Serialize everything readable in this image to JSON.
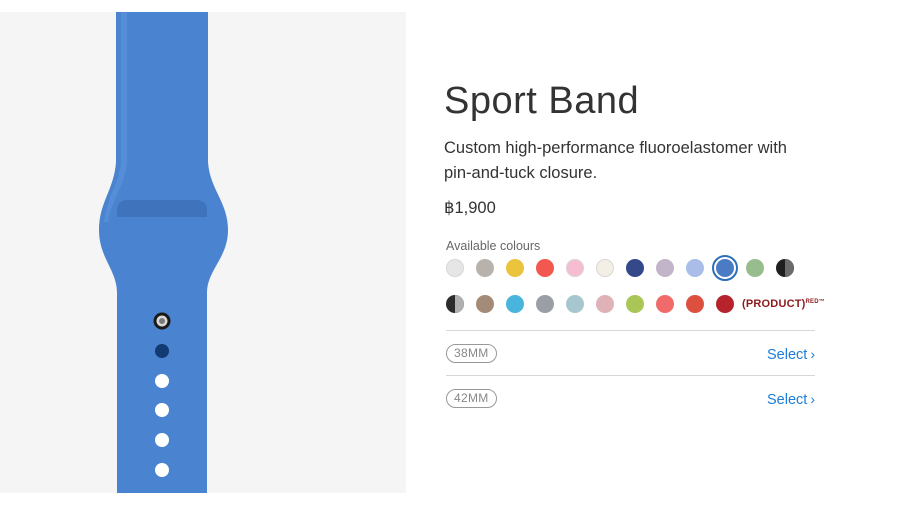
{
  "product": {
    "title": "Sport Band",
    "description_line1": "Custom high-performance fluoroelastomer with",
    "description_line2": "pin-and-tuck closure.",
    "price": "฿1,900"
  },
  "colours": {
    "label": "Available colours",
    "row1": [
      {
        "name": "white",
        "color": "#e6e6e6"
      },
      {
        "name": "stone",
        "color": "#b8b2ad"
      },
      {
        "name": "yellow",
        "color": "#e9c43c"
      },
      {
        "name": "orange-red",
        "color": "#f2584f"
      },
      {
        "name": "pink",
        "color": "#f5bcd2"
      },
      {
        "name": "antique-white",
        "color": "#f3efe5"
      },
      {
        "name": "midnight-blue",
        "color": "#35498a"
      },
      {
        "name": "lavender",
        "color": "#c2b5c9"
      },
      {
        "name": "light-blue",
        "color": "#a9bde8"
      },
      {
        "name": "royal-blue",
        "color": "#4a7bc4",
        "selected": true
      },
      {
        "name": "mint-green",
        "color": "#97bd8f"
      },
      {
        "name": "black-grey-split",
        "color": "#1f1f1f",
        "split": "#6b6b6b"
      }
    ],
    "row2": [
      {
        "name": "black-white-split",
        "color": "#2b2b2b",
        "split": "#b0b0b0"
      },
      {
        "name": "cocoa",
        "color": "#a38b78"
      },
      {
        "name": "turquoise",
        "color": "#4ab5dc"
      },
      {
        "name": "grey",
        "color": "#9a9fa6"
      },
      {
        "name": "pale-blue",
        "color": "#a6c7cf"
      },
      {
        "name": "light-pink",
        "color": "#dfb2b8"
      },
      {
        "name": "lime-green",
        "color": "#a9c657"
      },
      {
        "name": "coral",
        "color": "#f26b6b"
      },
      {
        "name": "red-orange",
        "color": "#dd5040"
      },
      {
        "name": "dark-red",
        "color": "#b7232c"
      }
    ],
    "product_red_label": "(PRODUCT)",
    "product_red_super": "RED™"
  },
  "sizes": [
    {
      "label": "38MM",
      "action": "Select"
    },
    {
      "label": "42MM",
      "action": "Select"
    }
  ],
  "band_image": {
    "band_color": "#4a83cf",
    "background": "#f5f5f5"
  }
}
